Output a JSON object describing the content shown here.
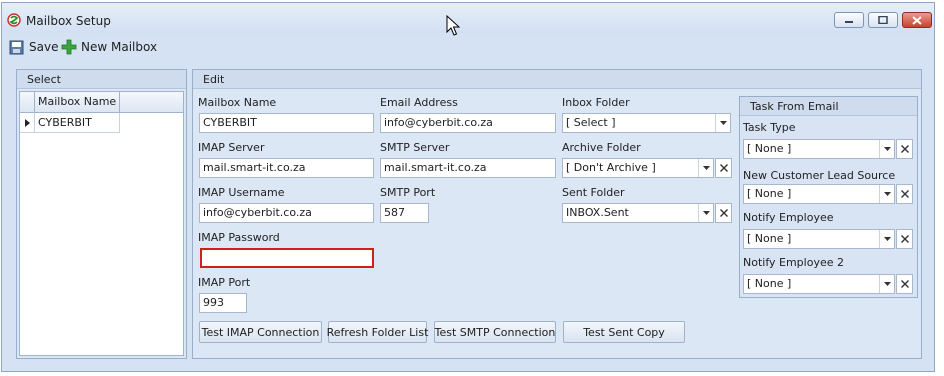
{
  "window": {
    "title": "Mailbox Setup"
  },
  "toolbar": {
    "save_label": "Save",
    "new_mailbox_label": "New Mailbox"
  },
  "select_panel": {
    "title": "Select",
    "column_header": "Mailbox Name",
    "rows": [
      {
        "name": "CYBERBIT",
        "selected": true
      }
    ]
  },
  "edit_panel": {
    "title": "Edit",
    "mailbox_name": {
      "label": "Mailbox Name",
      "value": "CYBERBIT"
    },
    "email_address": {
      "label": "Email Address",
      "value": "info@cyberbit.co.za"
    },
    "inbox_folder": {
      "label": "Inbox Folder",
      "value": "[ Select ]"
    },
    "imap_server": {
      "label": "IMAP Server",
      "value": "mail.smart-it.co.za"
    },
    "smtp_server": {
      "label": "SMTP Server",
      "value": "mail.smart-it.co.za"
    },
    "archive_folder": {
      "label": "Archive Folder",
      "value": "[ Don't Archive ]"
    },
    "imap_username": {
      "label": "IMAP Username",
      "value": "info@cyberbit.co.za"
    },
    "smtp_port": {
      "label": "SMTP Port",
      "value": "587"
    },
    "sent_folder": {
      "label": "Sent Folder",
      "value": "INBOX.Sent"
    },
    "imap_password": {
      "label": "IMAP Password",
      "value": ""
    },
    "imap_port": {
      "label": "IMAP Port",
      "value": "993"
    },
    "buttons": {
      "test_imap": "Test IMAP Connection",
      "refresh_folders": "Refresh Folder List",
      "test_smtp": "Test SMTP Connection",
      "test_sent": "Test Sent Copy"
    }
  },
  "task_panel": {
    "title": "Task From Email",
    "task_type": {
      "label": "Task Type",
      "value": "[ None ]"
    },
    "lead_source": {
      "label": "New Customer Lead Source",
      "value": "[ None ]"
    },
    "notify_employee": {
      "label": "Notify Employee",
      "value": "[ None ]"
    },
    "notify_employee_2": {
      "label": "Notify Employee 2",
      "value": "[ None ]"
    }
  },
  "colors": {
    "accent": "#d5e2f3",
    "error_border": "#d11d1d",
    "close_button": "#c94230"
  },
  "icons": [
    "app-logo-icon",
    "save-disk-icon",
    "green-plus-icon",
    "minimize-icon",
    "maximize-icon",
    "close-icon",
    "dropdown-arrow-icon",
    "clear-x-icon",
    "row-pointer-icon"
  ]
}
